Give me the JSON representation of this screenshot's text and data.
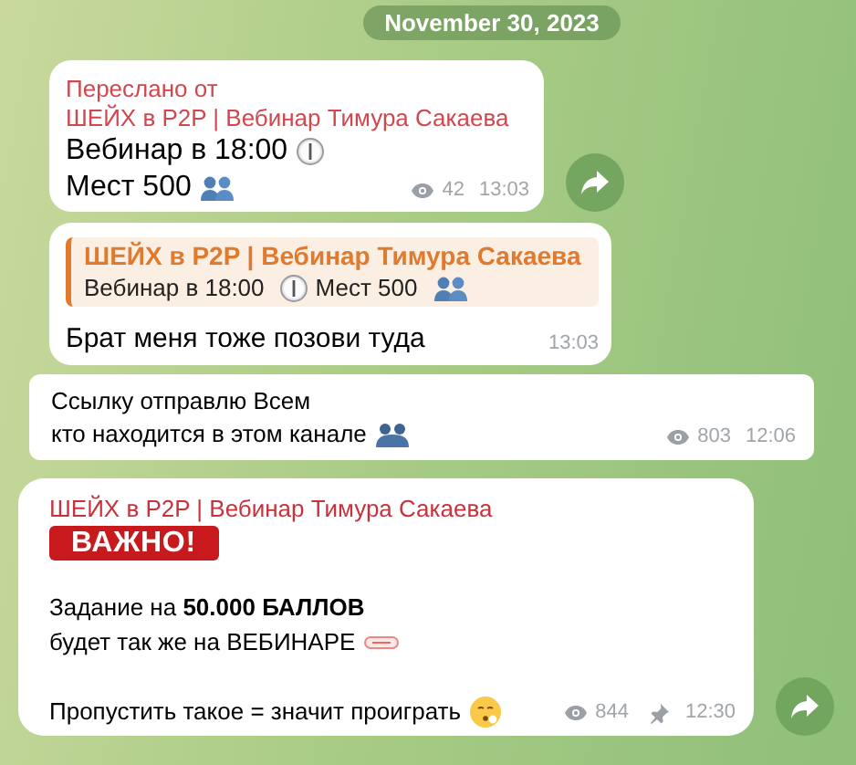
{
  "date_pill": "November 30, 2023",
  "messages": [
    {
      "kind": "forwarded",
      "forwarded_label": "Переслано от",
      "source": "ШЕЙХ в P2P | Вебинар Тимура Сакаева",
      "paragraphs": [
        [
          "Вебинар в 18:00",
          "Мест 500"
        ]
      ],
      "views": "42",
      "time": "13:03",
      "forward_button": true
    },
    {
      "kind": "reply",
      "reply": {
        "source": "ШЕЙХ в P2P | Вебинар Тимура Сакаева",
        "segments": [
          "Вебинар в 18:00",
          "Мест 500"
        ]
      },
      "paragraphs": [
        [
          "Брат меня тоже позови туда"
        ]
      ],
      "time": "13:03"
    },
    {
      "kind": "channel_post",
      "paragraphs": [
        [
          "Ссылку отправлю Всем",
          "кто находится в этом канале"
        ]
      ],
      "views": "803",
      "time": "12:06"
    },
    {
      "kind": "channel_post",
      "source": "ШЕЙХ в P2P | Вебинар Тимура Сакаева",
      "badge": "ВАЖНО!",
      "paragraphs": [
        [
          "Задание на **50.000 БАЛЛОВ**",
          "будет так же на ВЕБИНАРЕ"
        ],
        [
          "Пропустить такое = значит проиграть"
        ]
      ],
      "views": "844",
      "pinned": true,
      "time": "12:30",
      "forward_button": true
    }
  ]
}
